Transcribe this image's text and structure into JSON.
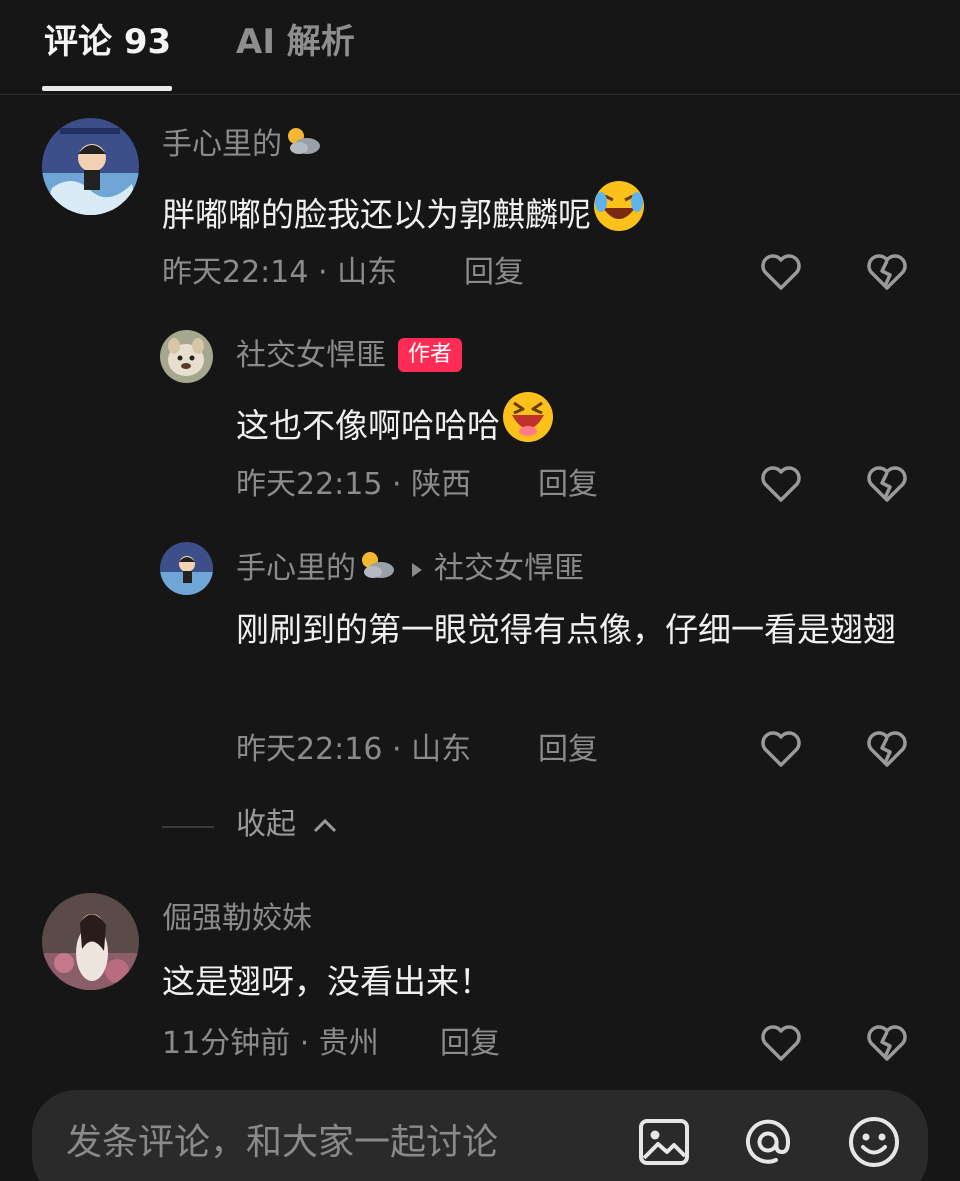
{
  "tabs": {
    "comments_label": "评论 93",
    "ai_label": "AI 解析"
  },
  "comments": [
    {
      "username": "手心里的",
      "username_emoji": "sun-behind-cloud",
      "text": "胖嘟嘟的脸我还以为郭麒麟呢",
      "text_emoji": "rolling-laughing-face",
      "meta": "昨天22:14 · 山东",
      "reply_label": "回复"
    },
    {
      "username": "社交女悍匪",
      "badge": "作者",
      "text": "这也不像啊哈哈哈",
      "text_emoji": "laughing-face",
      "meta": "昨天22:15 · 陕西",
      "reply_label": "回复"
    },
    {
      "username": "手心里的",
      "username_emoji": "sun-behind-cloud",
      "reply_to": "社交女悍匪",
      "text": "刚刷到的第一眼觉得有点像，仔细一看是翅翅",
      "meta": "昨天22:16 · 山东",
      "reply_label": "回复"
    },
    {
      "username": "倔强勒姣妹",
      "text": "这是翅呀，没看出来！",
      "meta": "11分钟前 · 贵州",
      "reply_label": "回复"
    }
  ],
  "collapse_label": "收起",
  "input": {
    "placeholder": "发条评论，和大家一起讨论"
  },
  "colors": {
    "background": "#161616",
    "badge": "#fe2c55",
    "muted_text": "#8b8b8b"
  }
}
